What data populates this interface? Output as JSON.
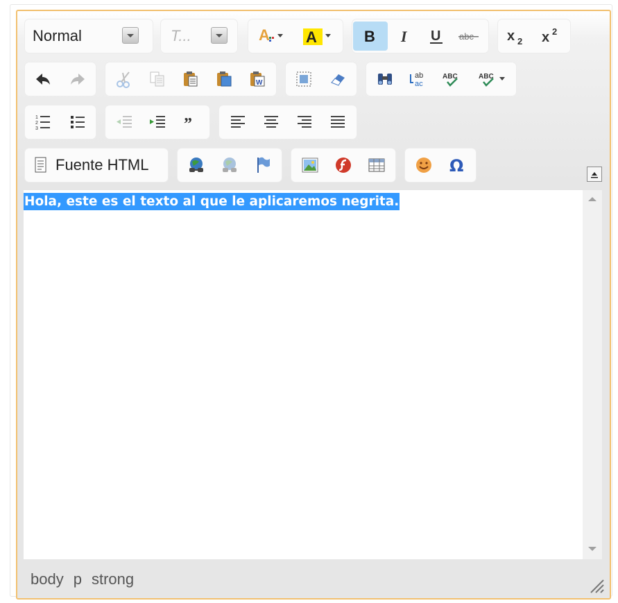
{
  "toolbar": {
    "format_combo": {
      "value": "Normal"
    },
    "font_combo": {
      "placeholder": "T..."
    },
    "source_button": {
      "label": "Fuente HTML"
    }
  },
  "content": {
    "text": "Hola, este es el texto al que le aplicaremos negrita."
  },
  "statusbar": {
    "path": [
      "body",
      "p",
      "strong"
    ]
  },
  "colors": {
    "border_accent": "#f2c06f",
    "selection": "#3399ff",
    "active_button": "#b7dcf5"
  }
}
